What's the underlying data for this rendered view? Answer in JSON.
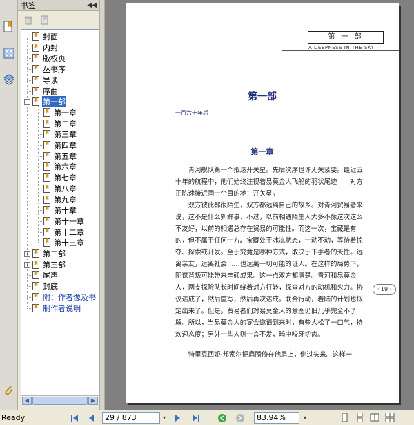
{
  "panel": {
    "title": "书签",
    "collapse_symbol": "◀◀"
  },
  "bookmarks": [
    {
      "label": "封面",
      "level": 0
    },
    {
      "label": "内封",
      "level": 0
    },
    {
      "label": "版权页",
      "level": 0
    },
    {
      "label": "丛书序",
      "level": 0
    },
    {
      "label": "导读",
      "level": 0
    },
    {
      "label": "序曲",
      "level": 0
    },
    {
      "label": "第一部",
      "level": 0,
      "expanded": true,
      "selected": true
    },
    {
      "label": "第一章",
      "level": 1
    },
    {
      "label": "第二章",
      "level": 1
    },
    {
      "label": "第三章",
      "level": 1
    },
    {
      "label": "第四章",
      "level": 1
    },
    {
      "label": "第五章",
      "level": 1
    },
    {
      "label": "第六章",
      "level": 1
    },
    {
      "label": "第七章",
      "level": 1
    },
    {
      "label": "第八章",
      "level": 1
    },
    {
      "label": "第九章",
      "level": 1
    },
    {
      "label": "第十章",
      "level": 1
    },
    {
      "label": "第十一章",
      "level": 1
    },
    {
      "label": "第十二章",
      "level": 1
    },
    {
      "label": "第十三章",
      "level": 1
    },
    {
      "label": "第二部",
      "level": 0,
      "collapsed": true
    },
    {
      "label": "第三部",
      "level": 0,
      "collapsed": true
    },
    {
      "label": "尾声",
      "level": 0
    },
    {
      "label": "封底",
      "level": 0
    },
    {
      "label": "附：作者像及书",
      "level": 0,
      "link": true
    },
    {
      "label": "制作者说明",
      "level": 0,
      "link": true
    }
  ],
  "expander": {
    "minus": "−",
    "plus": "+"
  },
  "page": {
    "header_box": "第 一 部",
    "header_sub": "A DEEPNESS IN THE SKY",
    "part_title": "第一部",
    "part_subtitle": "一百六十年后",
    "chapter_title": "第一章",
    "paragraphs": [
      "青河舰队第一个抵达开关星。先后次序也许无关紧要。最近五十年的航程中，他们始终注视着易莫金人飞船的羽状尾迹——对方正陈速接近同一个目的地：开关星。",
      "双方彼此都很陌生，双方都远离自己的故乡。对青河贸易者来说，这不是什么新鲜事，不过，以前相遇陌生人大多不像这次这么不友好，以前的相遇总存在贸易的可能性。而这一次，宝藏是有的，但不属于任何一方。宝藏处于冰冻状态，一动不动，等待着掠夺、探索或开发。至于究竟是哪种方式，取决于下手者的天性。远离亲友，远离社会……也远离一切可能的证人。在这样的局势下，阴谋背叛可能带来丰硕成果。这一点双方都清楚。青河和易莫金人，两支探险队长时间绕着对方打转，探查对方的动机和火力。协议达成了，然后重写，然后再次达成。联合行动，着陆的计划也拟定出来了。但是，贸易者们对易莫金人的意图仍旧几乎完全不了解。所以，当易莫金人的宴会邀请到来时，有些人松了一口气，持欢迎态度；另外一些人则一言不发，暗中咬牙切齿。",
      "特里克西娅·邦索尔把肩膀倚在他肩上，侧过头来。这样一"
    ],
    "page_number": "· 19 ·"
  },
  "status": {
    "text": "Ready",
    "page_field": "29 / 873",
    "zoom_field": "83.94%",
    "dropdown": "▾"
  },
  "colors": {
    "selected_bg": "#316ac5",
    "link_text": "#1a3fa6",
    "title_blue": "#1f2f7a",
    "doc_bg": "#808080"
  }
}
